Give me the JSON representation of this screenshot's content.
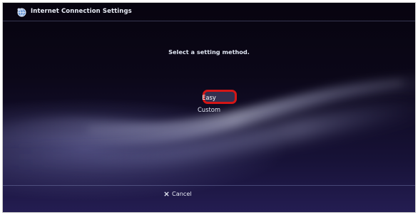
{
  "window": {
    "title": "Internet Connection Settings"
  },
  "main": {
    "prompt": "Select a setting method.",
    "options": [
      {
        "label": "Easy",
        "selected": true
      },
      {
        "label": "Custom",
        "selected": false
      }
    ]
  },
  "footer": {
    "cancel_label": "Cancel",
    "cancel_icon": "cross-icon"
  },
  "colors": {
    "highlight_ring": "#d51616",
    "background": "#050210"
  },
  "icons": {
    "title_icon": "network-settings-icon"
  }
}
